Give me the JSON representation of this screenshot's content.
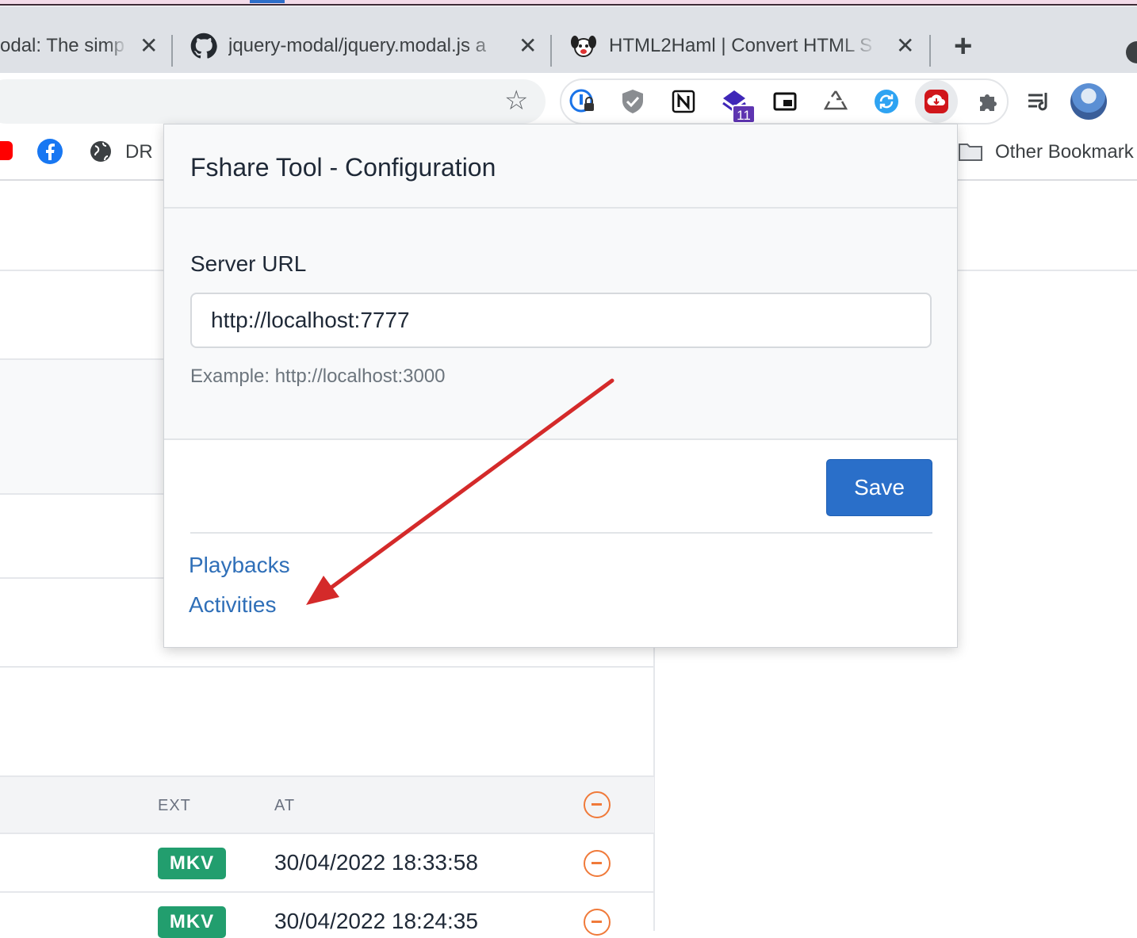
{
  "browser": {
    "tabs": [
      {
        "title": "odal: The simp",
        "close": "✕"
      },
      {
        "title": "jquery-modal/jquery.modal.js a",
        "close": "✕"
      },
      {
        "title": "HTML2Haml | Convert HTML S",
        "close": "✕"
      }
    ],
    "new_tab": "+",
    "extension_badge": "11",
    "bookmarks": [
      {
        "label": "DR"
      },
      {
        "label": "Other Bookmark"
      }
    ]
  },
  "background_table": {
    "headers": {
      "ext": "EXT",
      "at": "AT"
    },
    "rows": [
      {
        "ext": "MKV",
        "at": "30/04/2022 18:33:58"
      },
      {
        "ext": "MKV",
        "at": "30/04/2022 18:24:35"
      }
    ]
  },
  "popup": {
    "title": "Fshare Tool - Configuration",
    "server_url": {
      "label": "Server URL",
      "value": "http://localhost:7777",
      "help": "Example: http://localhost:3000"
    },
    "save_label": "Save",
    "links": [
      {
        "label": "Playbacks"
      },
      {
        "label": "Activities"
      }
    ]
  },
  "colors": {
    "accent": "#2a6fc9",
    "link": "#2f6fb8",
    "badge_green": "#229e6e",
    "remove_orange": "#f07a3a",
    "annotation_arrow": "#d42a2a"
  }
}
